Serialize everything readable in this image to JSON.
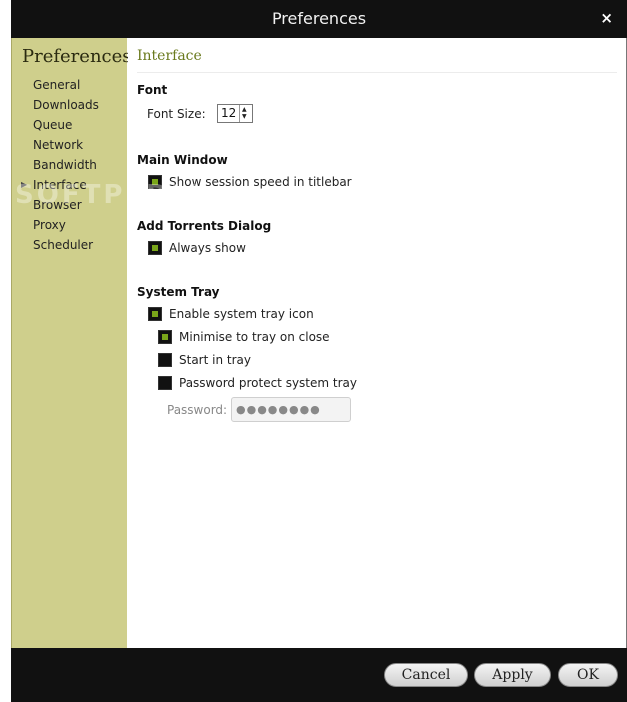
{
  "window": {
    "title": "Preferences",
    "close_glyph": "×"
  },
  "sidebar": {
    "title": "Preferences",
    "active_marker": "▶",
    "items": [
      {
        "label": "General"
      },
      {
        "label": "Downloads"
      },
      {
        "label": "Queue"
      },
      {
        "label": "Network"
      },
      {
        "label": "Bandwidth"
      },
      {
        "label": "Interface"
      },
      {
        "label": "Browser"
      },
      {
        "label": "Proxy"
      },
      {
        "label": "Scheduler"
      }
    ],
    "active_item": "Interface"
  },
  "content": {
    "section_title": "Interface",
    "font": {
      "heading": "Font",
      "size_label": "Font Size:",
      "size_value": "12"
    },
    "main_window": {
      "heading": "Main Window",
      "show_speed_label": "Show session speed in titlebar",
      "show_speed_checked": true
    },
    "add_torrents": {
      "heading": "Add Torrents Dialog",
      "always_show_label": "Always show",
      "always_show_checked": true
    },
    "system_tray": {
      "heading": "System Tray",
      "enable_label": "Enable system tray icon",
      "enable_checked": true,
      "minimise_label": "Minimise to tray on close",
      "minimise_checked": true,
      "start_label": "Start in tray",
      "start_checked": false,
      "password_protect_label": "Password protect system tray",
      "password_protect_checked": false,
      "password_label": "Password:",
      "password_value": "●●●●●●●●"
    }
  },
  "footer": {
    "cancel_label": "Cancel",
    "apply_label": "Apply",
    "ok_label": "OK"
  },
  "watermark": "SOFTPEDIA",
  "colors": {
    "accent": "#7aa61a",
    "sidebar_bg": "#cfcf8c",
    "section_title": "#6a7a1e",
    "chrome": "#111111"
  }
}
